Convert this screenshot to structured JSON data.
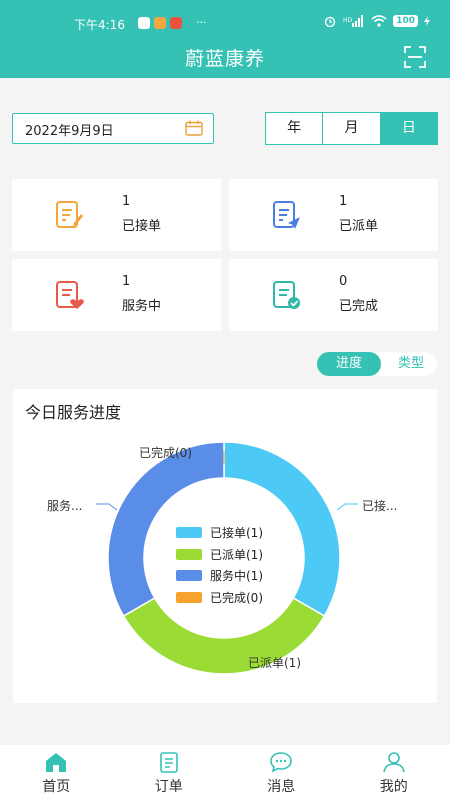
{
  "status_bar": {
    "time": "下午4:16",
    "battery": "100",
    "dots": "···"
  },
  "header": {
    "title": "蔚蓝康养"
  },
  "date_picker": {
    "value": "2022年9月9日"
  },
  "period_tabs": [
    "年",
    "月",
    "日"
  ],
  "stats": [
    {
      "count": "1",
      "label": "已接单"
    },
    {
      "count": "1",
      "label": "已派单"
    },
    {
      "count": "1",
      "label": "服务中"
    },
    {
      "count": "0",
      "label": "已完成"
    }
  ],
  "view_toggle": {
    "active": "进度",
    "inactive": "类型"
  },
  "progress_card": {
    "title": "今日服务进度",
    "labels": {
      "top": "已完成(0)",
      "right": "已接...",
      "left": "服务...",
      "bottom": "已派单(1)"
    }
  },
  "chart_data": {
    "type": "pie",
    "title": "今日服务进度",
    "series": [
      {
        "name": "已接单(1)",
        "value": 1,
        "color": "#4dc9f6"
      },
      {
        "name": "已派单(1)",
        "value": 1,
        "color": "#9bdb36"
      },
      {
        "name": "服务中(1)",
        "value": 1,
        "color": "#5a8de8"
      },
      {
        "name": "已完成(0)",
        "value": 0,
        "color": "#f7a22c"
      }
    ]
  },
  "bottom_nav": [
    "首页",
    "订单",
    "消息",
    "我的"
  ],
  "colors": {
    "accent": "#35c2b5"
  }
}
